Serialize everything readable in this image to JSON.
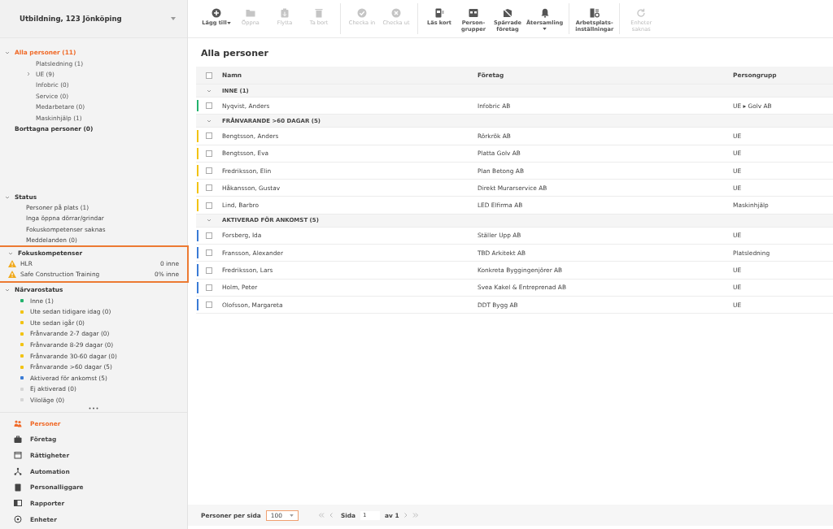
{
  "site_selector": {
    "label": "Utbildning, 123 Jönköping"
  },
  "tree": [
    {
      "label": "Alla personer (11)",
      "selected": true,
      "expanded": true,
      "children": [
        {
          "label": "Platsledning (1)",
          "selected": false
        },
        {
          "label": "UE (9)",
          "selected": false,
          "expanded": false
        },
        {
          "label": "Infobric (0)",
          "selected": false
        },
        {
          "label": "Service (0)",
          "selected": false
        },
        {
          "label": "Medarbetare (0)",
          "selected": false
        },
        {
          "label": "Maskinhjälp (1)",
          "selected": false
        }
      ]
    },
    {
      "label": "Borttagna personer (0)",
      "selected": false
    }
  ],
  "status": {
    "title": "Status",
    "expanded": true,
    "items": [
      "Personer på plats (1)",
      "Inga öppna dörrar/grindar",
      "Fokuskompetenser saknas",
      "Meddelanden (0)"
    ]
  },
  "focus_skills": {
    "title": "Fokuskompetenser",
    "expanded": true,
    "highlighted": true,
    "items": [
      {
        "label": "HLR",
        "value": "0 inne"
      },
      {
        "label": "Safe Construction Training",
        "value": "0% inne"
      }
    ]
  },
  "attendance": {
    "title": "Närvarostatus",
    "expanded": true,
    "items": [
      {
        "label": "Inne (1)",
        "color": "#23b26d"
      },
      {
        "label": "Ute sedan tidigare idag (0)",
        "color": "#f2c313"
      },
      {
        "label": "Ute sedan igår (0)",
        "color": "#f2c313"
      },
      {
        "label": "Frånvarande 2-7 dagar (0)",
        "color": "#f2c313"
      },
      {
        "label": "Frånvarande 8-29 dagar (0)",
        "color": "#f2c313"
      },
      {
        "label": "Frånvarande 30-60 dagar (0)",
        "color": "#f2c313"
      },
      {
        "label": "Frånvarande >60 dagar (5)",
        "color": "#f2c313"
      },
      {
        "label": "Aktiverad för ankomst (5)",
        "color": "#3a7bd5"
      },
      {
        "label": "Ej aktiverad (0)",
        "color": "#d6d6d6"
      },
      {
        "label": "Viloläge (0)",
        "color": "#d6d6d6"
      }
    ]
  },
  "nav": [
    {
      "label": "Personer",
      "selected": true
    },
    {
      "label": "Företag",
      "selected": false
    },
    {
      "label": "Rättigheter",
      "selected": false
    },
    {
      "label": "Automation",
      "selected": false
    },
    {
      "label": "Personalliggare",
      "selected": false
    },
    {
      "label": "Rapporter",
      "selected": false
    },
    {
      "label": "Enheter",
      "selected": false
    }
  ],
  "toolbar": [
    [
      {
        "label": "Lägg till",
        "disabled": false,
        "dropdown": true
      },
      {
        "label": "Öppna",
        "disabled": true,
        "dropdown": false
      },
      {
        "label": "Flytta",
        "disabled": true,
        "dropdown": false
      },
      {
        "label": "Ta bort",
        "disabled": true,
        "dropdown": false
      }
    ],
    [
      {
        "label": "Checka in",
        "disabled": true,
        "dropdown": false
      },
      {
        "label": "Checka ut",
        "disabled": true,
        "dropdown": false
      }
    ],
    [
      {
        "label": "Läs kort",
        "disabled": false,
        "dropdown": false
      },
      {
        "label": "Person-\ngrupper",
        "disabled": false,
        "dropdown": false
      },
      {
        "label": "Spärrade\nföretag",
        "disabled": false,
        "dropdown": false
      },
      {
        "label": "Återsamling",
        "disabled": false,
        "dropdown": true
      }
    ],
    [
      {
        "label": "Arbetsplats-\ninställningar",
        "disabled": false,
        "dropdown": false
      }
    ],
    [
      {
        "label": "Enheter\nsaknas",
        "disabled": true,
        "dropdown": false
      }
    ]
  ],
  "page_title": "Alla personer",
  "table": {
    "columns": [
      "Namn",
      "Företag",
      "Persongrupp"
    ],
    "header_checked": false,
    "groups": [
      {
        "label": "INNE (1)",
        "expanded": true,
        "color": "#23b26d",
        "rows": [
          {
            "name": "Nyqvist, Anders",
            "company": "Infobric AB",
            "group": "UE ▸ Golv AB",
            "checked": false
          }
        ]
      },
      {
        "label": "FRÅNVARANDE >60 DAGAR (5)",
        "expanded": true,
        "color": "#f2c313",
        "rows": [
          {
            "name": "Bengtsson, Anders",
            "company": "Rörkrök AB",
            "group": "UE",
            "checked": false
          },
          {
            "name": "Bengtsson, Eva",
            "company": "Platta Golv AB",
            "group": "UE",
            "checked": false
          },
          {
            "name": "Fredriksson, Elin",
            "company": "Plan Betong AB",
            "group": "UE",
            "checked": false
          },
          {
            "name": "Håkansson, Gustav",
            "company": "Direkt Murarservice AB",
            "group": "UE",
            "checked": false
          },
          {
            "name": "Lind, Barbro",
            "company": "LED Elfirma AB",
            "group": "Maskinhjälp",
            "checked": false
          }
        ]
      },
      {
        "label": "AKTIVERAD FÖR ANKOMST (5)",
        "expanded": true,
        "color": "#3a7bd5",
        "rows": [
          {
            "name": "Forsberg, Ida",
            "company": "Ställer Upp AB",
            "group": "UE",
            "checked": false
          },
          {
            "name": "Fransson, Alexander",
            "company": "TBD Arkitekt AB",
            "group": "Platsledning",
            "checked": false
          },
          {
            "name": "Fredriksson, Lars",
            "company": "Konkreta Byggingenjörer AB",
            "group": "UE",
            "checked": false
          },
          {
            "name": "Holm, Peter",
            "company": "Svea Kakel & Entreprenad AB",
            "group": "UE",
            "checked": false
          },
          {
            "name": "Olofsson, Margareta",
            "company": "DDT Bygg AB",
            "group": "UE",
            "checked": false
          }
        ]
      }
    ]
  },
  "footer": {
    "per_page_label": "Personer per sida",
    "per_page": "100",
    "page_label": "Sida",
    "page": "1",
    "page_total": "av 1"
  }
}
